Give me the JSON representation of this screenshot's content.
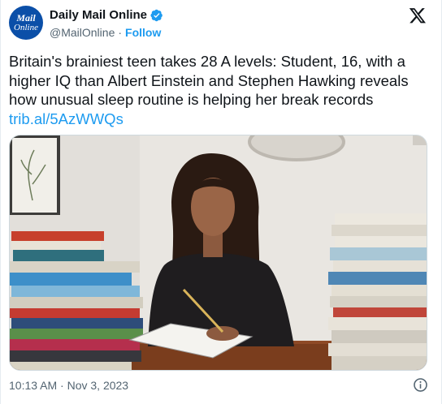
{
  "account": {
    "avatar_line1": "Mail",
    "avatar_line2": "Online",
    "name": "Daily Mail Online",
    "handle": "@MailOnline",
    "separator": "·",
    "follow_label": "Follow"
  },
  "tweet": {
    "text": "Britain's brainiest teen takes 28 A levels: Student, 16, with a higher IQ than Albert Einstein and Stephen Hawking reveals how unusual sleep routine is helping her break records",
    "link": "trib.al/5AzWWQs",
    "timestamp": "10:13 AM · Nov 3, 2023"
  },
  "icons": {
    "verified": "verified-badge-icon",
    "logo": "x-logo-icon",
    "info": "info-icon"
  },
  "colors": {
    "accent": "#1d9bf0",
    "avatar_bg": "#0b4fa8",
    "muted_text": "#536471"
  }
}
